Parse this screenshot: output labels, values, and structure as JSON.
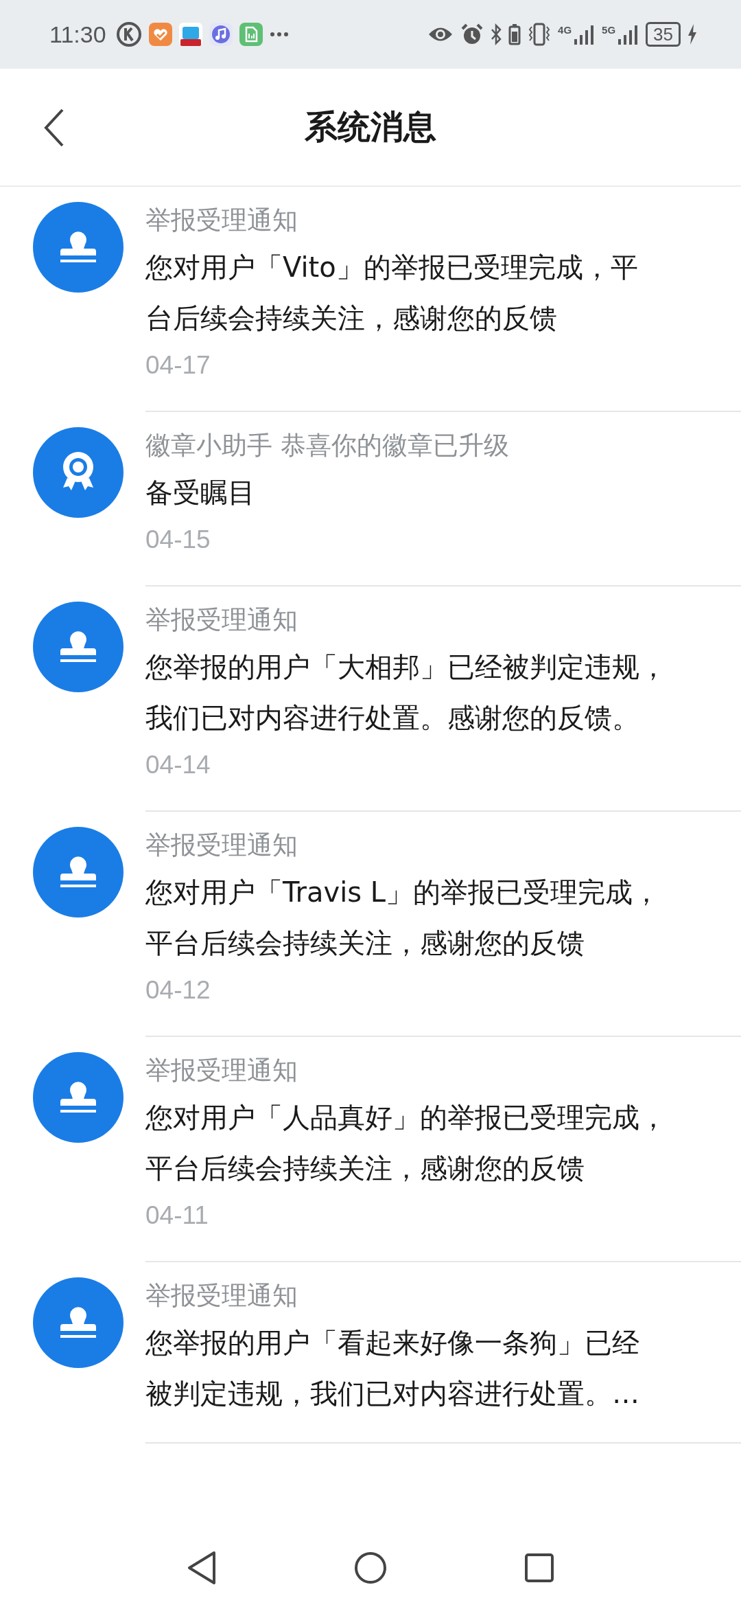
{
  "status_bar": {
    "time": "11:30",
    "network_1": "4G",
    "network_2": "5G",
    "battery": "35"
  },
  "header": {
    "title": "系统消息"
  },
  "messages": [
    {
      "kind": "stamp",
      "title": "举报受理通知",
      "body_lines": [
        "您对用户「Vito」的举报已受理完成，平",
        "台后续会持续关注，感谢您的反馈"
      ],
      "date": "04-17"
    },
    {
      "kind": "badge",
      "title": "徽章小助手 恭喜你的徽章已升级",
      "body_lines": [
        "备受瞩目"
      ],
      "date": "04-15"
    },
    {
      "kind": "stamp",
      "title": "举报受理通知",
      "body_lines": [
        "您举报的用户「大相邦」已经被判定违规，",
        "我们已对内容进行处置。感谢您的反馈。"
      ],
      "date": "04-14"
    },
    {
      "kind": "stamp",
      "title": "举报受理通知",
      "body_lines": [
        "您对用户「Travis L」的举报已受理完成，",
        "平台后续会持续关注，感谢您的反馈"
      ],
      "date": "04-12"
    },
    {
      "kind": "stamp",
      "title": "举报受理通知",
      "body_lines": [
        "您对用户「人品真好」的举报已受理完成，",
        "平台后续会持续关注，感谢您的反馈"
      ],
      "date": "04-11"
    },
    {
      "kind": "stamp",
      "title": "举报受理通知",
      "body_lines": [
        "您举报的用户「看起来好像一条狗」已经",
        "被判定违规，我们已对内容进行处置。…"
      ]
    }
  ]
}
